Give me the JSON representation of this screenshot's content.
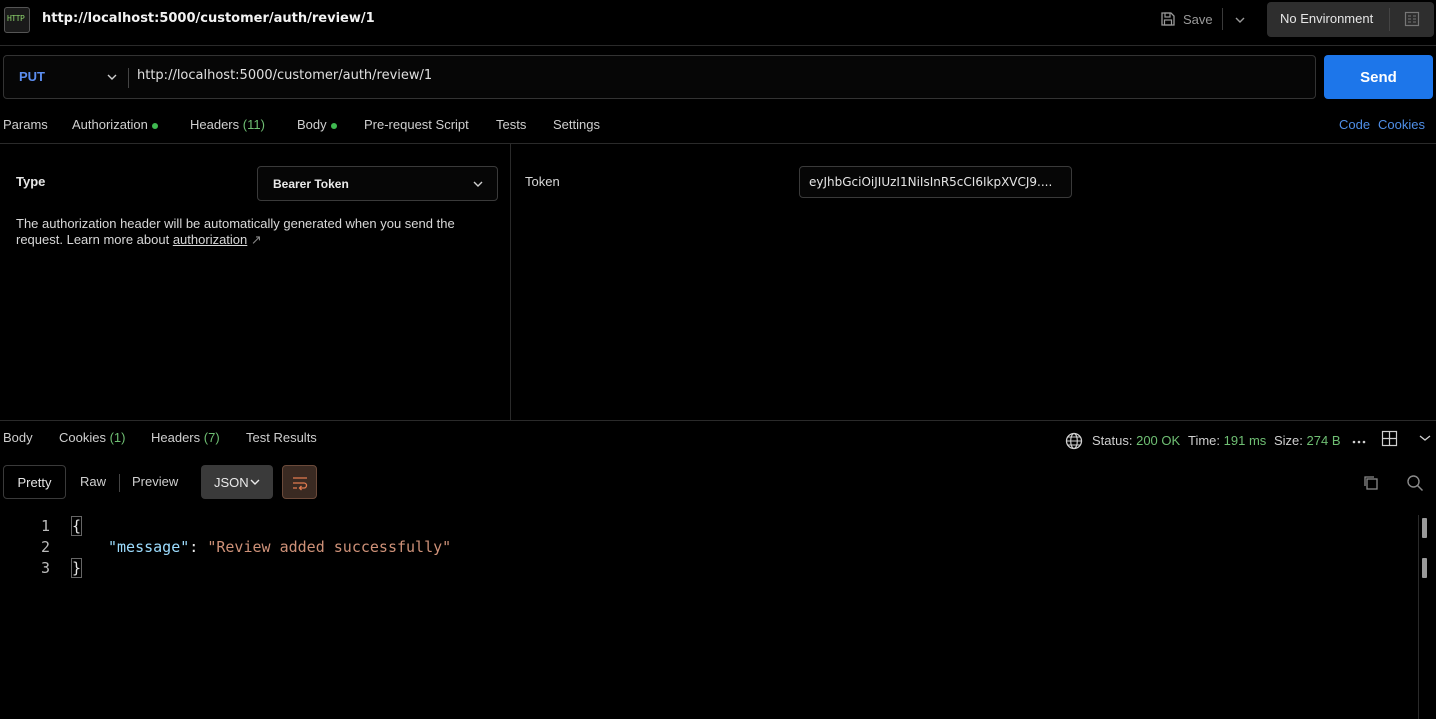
{
  "titlebar": {
    "icon_text": "HTTP",
    "title": "http://localhost:5000/customer/auth/review/1",
    "save_label": "Save",
    "environment": "No Environment"
  },
  "request": {
    "method": "PUT",
    "url": "http://localhost:5000/customer/auth/review/1",
    "send_label": "Send"
  },
  "request_tabs": {
    "params": "Params",
    "authorization": "Authorization",
    "headers": "Headers",
    "headers_count": "(11)",
    "body": "Body",
    "prerequest": "Pre-request Script",
    "tests": "Tests",
    "settings": "Settings",
    "code": "Code",
    "cookies": "Cookies"
  },
  "auth": {
    "type_label": "Type",
    "type_value": "Bearer Token",
    "description": "The authorization header will be automatically generated when you send the request. Learn more about ",
    "link_text": "authorization",
    "link_arrow": "↗",
    "token_label": "Token",
    "token_value": "eyJhbGciOiJIUzI1NiIsInR5cCI6IkpXVCJ9...."
  },
  "response_tabs": {
    "body": "Body",
    "cookies": "Cookies",
    "cookies_count": "(1)",
    "headers": "Headers",
    "headers_count": "(7)",
    "test_results": "Test Results"
  },
  "response_meta": {
    "status_label": "Status:",
    "status_value": "200 OK",
    "time_label": "Time:",
    "time_value": "191 ms",
    "size_label": "Size:",
    "size_value": "274 B"
  },
  "view_bar": {
    "pretty": "Pretty",
    "raw": "Raw",
    "preview": "Preview",
    "format": "JSON"
  },
  "code": {
    "lines": [
      {
        "num": "1",
        "open": "{"
      },
      {
        "num": "2",
        "key": "\"message\"",
        "colon": ": ",
        "value": "\"Review added successfully\""
      },
      {
        "num": "3",
        "close": "}"
      }
    ]
  },
  "colors": {
    "accent_blue": "#1d76ea",
    "method_blue": "#5c8ef0",
    "success_green": "#6fbf73",
    "json_key": "#9cdcfe",
    "json_string": "#ce9178"
  }
}
